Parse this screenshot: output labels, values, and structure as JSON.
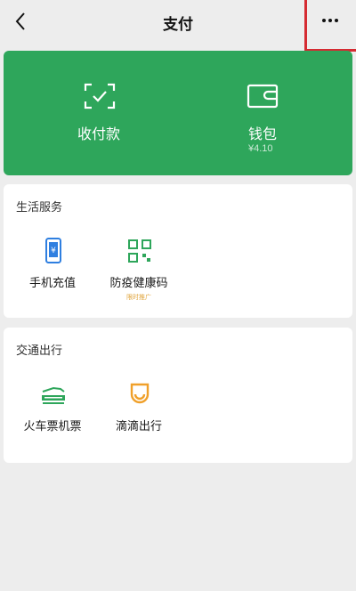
{
  "header": {
    "title": "支付",
    "back_icon": "chevron-left-icon",
    "more_icon": "more-dots-icon",
    "highlight_color": "#d52b32"
  },
  "wallet_card": {
    "color": "#2ea65b",
    "items": [
      {
        "label": "收付款",
        "icon": "scan-check-icon"
      },
      {
        "label": "钱包",
        "sub": "¥4.10",
        "icon": "wallet-icon"
      }
    ]
  },
  "sections": [
    {
      "title": "生活服务",
      "items": [
        {
          "label": "手机充值",
          "icon": "phone-recharge-icon",
          "accent": "#2f7fe0"
        },
        {
          "label": "防疫健康码",
          "icon": "qr-code-icon",
          "accent": "#2ea65b",
          "badge": "限时推广"
        }
      ]
    },
    {
      "title": "交通出行",
      "items": [
        {
          "label": "火车票机票",
          "icon": "train-icon",
          "accent": "#2ea65b"
        },
        {
          "label": "滴滴出行",
          "icon": "didi-icon",
          "accent": "#f0a02a"
        }
      ]
    }
  ]
}
